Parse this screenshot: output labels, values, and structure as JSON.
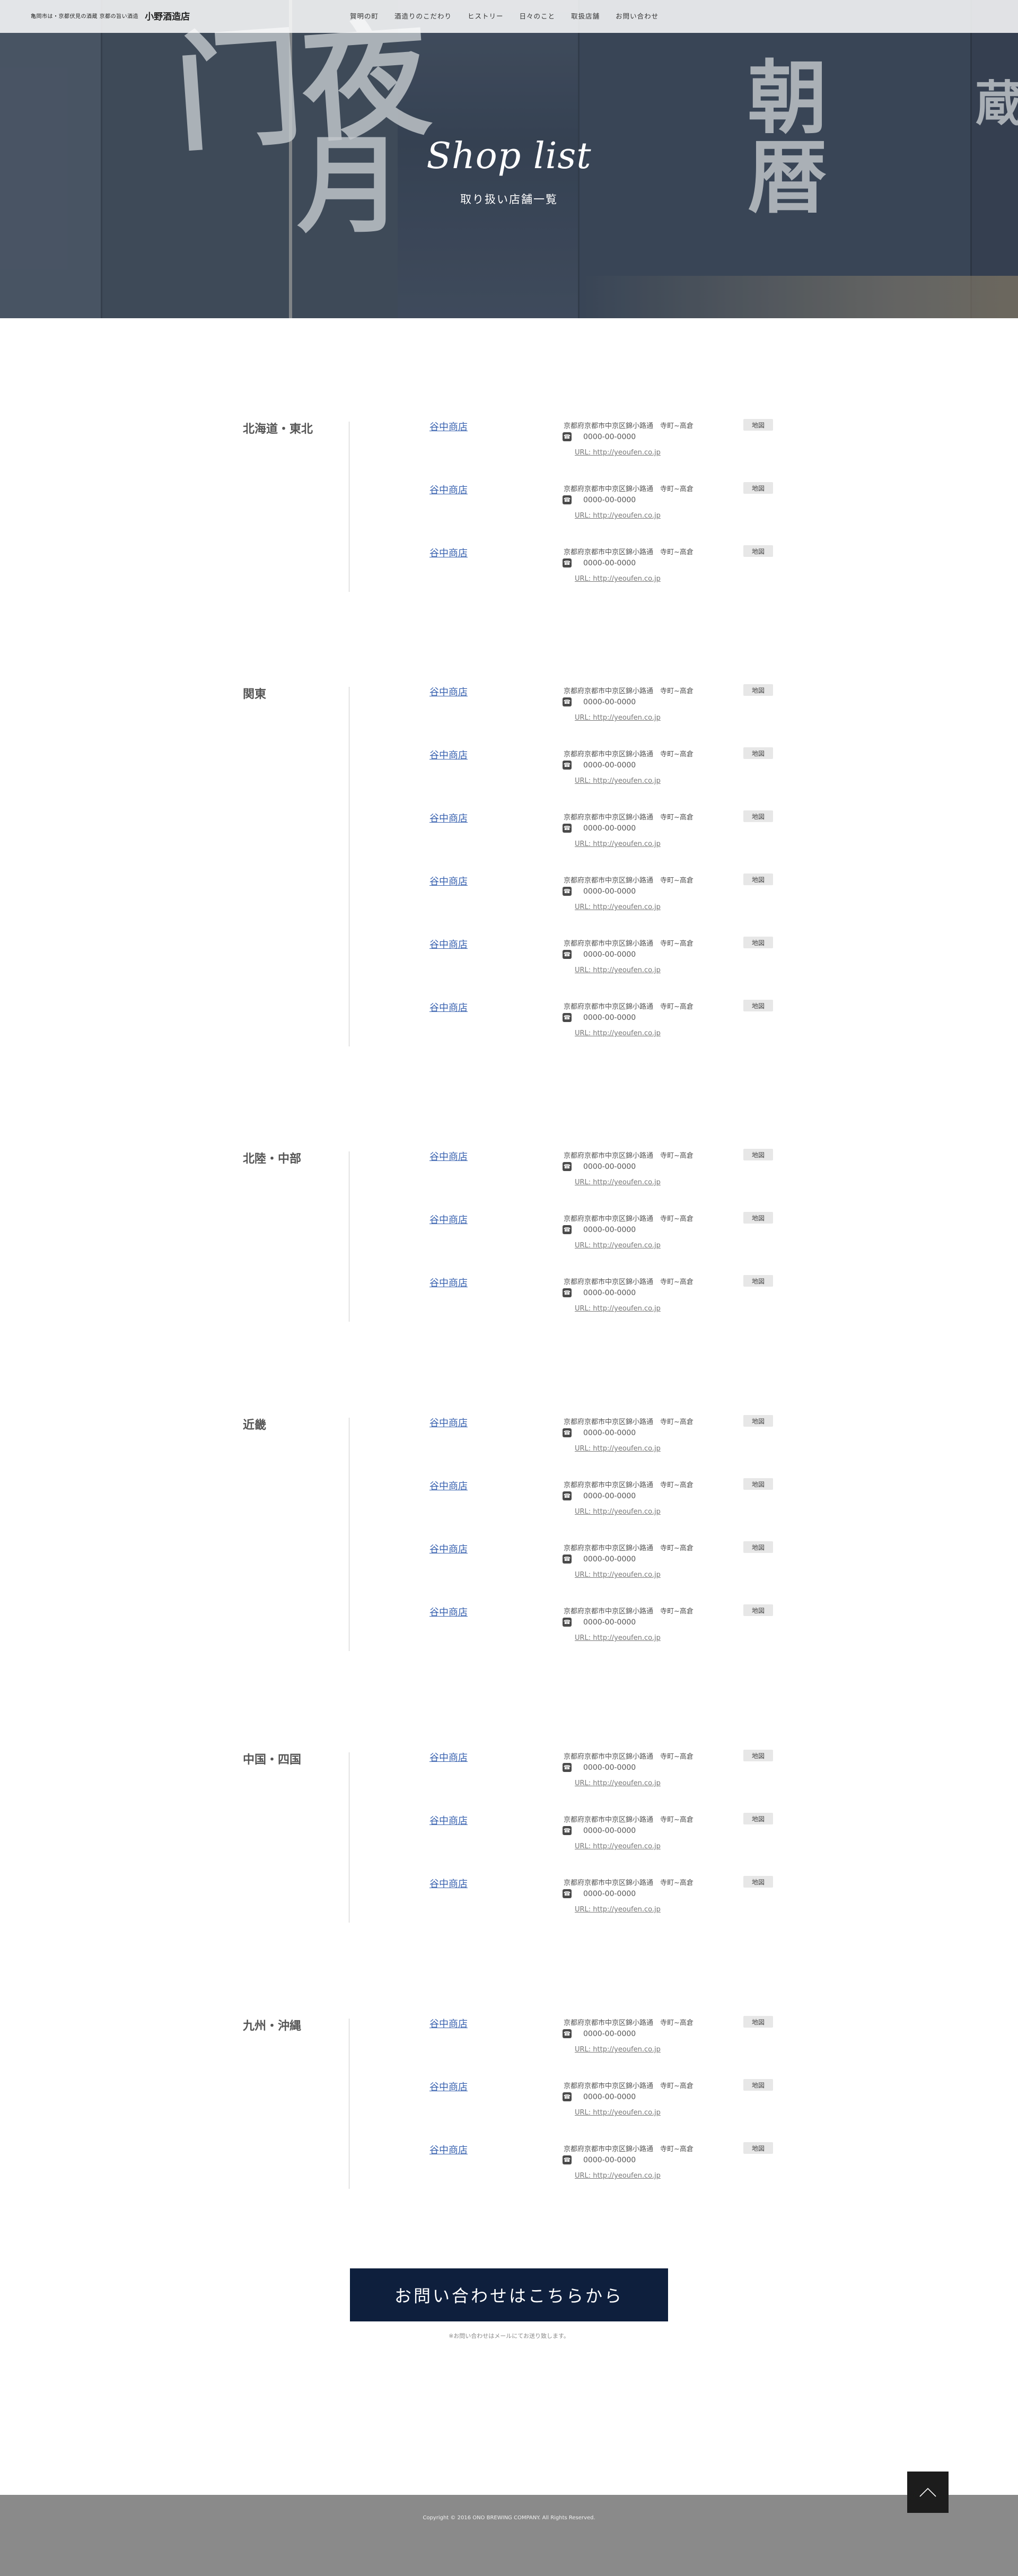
{
  "header": {
    "tagline": "亀岡市は・京都伏見の酒蔵 京都の旨い酒造",
    "brand_name": "小野酒造店",
    "nav": [
      "賀明の町",
      "酒造りのこだわり",
      "ヒストリー",
      "日々のこと",
      "取扱店舗",
      "お問い合わせ"
    ]
  },
  "hero": {
    "title": "Shop list",
    "subtitle": "取り扱い店舗一覧"
  },
  "regions": [
    {
      "name": "北海道・東北",
      "shops": [
        {
          "name": "谷中商店",
          "address": "京都府京都市中京区錦小路通　寺町~高倉",
          "tel": "0000-00-0000",
          "url": "URL: http://yeoufen.co.jp",
          "map": "地図"
        },
        {
          "name": "谷中商店",
          "address": "京都府京都市中京区錦小路通　寺町~高倉",
          "tel": "0000-00-0000",
          "url": "URL: http://yeoufen.co.jp",
          "map": "地図"
        },
        {
          "name": "谷中商店",
          "address": "京都府京都市中京区錦小路通　寺町~高倉",
          "tel": "0000-00-0000",
          "url": "URL: http://yeoufen.co.jp",
          "map": "地図"
        }
      ]
    },
    {
      "name": "関東",
      "shops": [
        {
          "name": "谷中商店",
          "address": "京都府京都市中京区錦小路通　寺町~高倉",
          "tel": "0000-00-0000",
          "url": "URL: http://yeoufen.co.jp",
          "map": "地図"
        },
        {
          "name": "谷中商店",
          "address": "京都府京都市中京区錦小路通　寺町~高倉",
          "tel": "0000-00-0000",
          "url": "URL: http://yeoufen.co.jp",
          "map": "地図"
        },
        {
          "name": "谷中商店",
          "address": "京都府京都市中京区錦小路通　寺町~高倉",
          "tel": "0000-00-0000",
          "url": "URL: http://yeoufen.co.jp",
          "map": "地図"
        },
        {
          "name": "谷中商店",
          "address": "京都府京都市中京区錦小路通　寺町~高倉",
          "tel": "0000-00-0000",
          "url": "URL: http://yeoufen.co.jp",
          "map": "地図"
        },
        {
          "name": "谷中商店",
          "address": "京都府京都市中京区錦小路通　寺町~高倉",
          "tel": "0000-00-0000",
          "url": "URL: http://yeoufen.co.jp",
          "map": "地図"
        },
        {
          "name": "谷中商店",
          "address": "京都府京都市中京区錦小路通　寺町~高倉",
          "tel": "0000-00-0000",
          "url": "URL: http://yeoufen.co.jp",
          "map": "地図"
        }
      ]
    },
    {
      "name": "北陸・中部",
      "shops": [
        {
          "name": "谷中商店",
          "address": "京都府京都市中京区錦小路通　寺町~高倉",
          "tel": "0000-00-0000",
          "url": "URL: http://yeoufen.co.jp",
          "map": "地図"
        },
        {
          "name": "谷中商店",
          "address": "京都府京都市中京区錦小路通　寺町~高倉",
          "tel": "0000-00-0000",
          "url": "URL: http://yeoufen.co.jp",
          "map": "地図"
        },
        {
          "name": "谷中商店",
          "address": "京都府京都市中京区錦小路通　寺町~高倉",
          "tel": "0000-00-0000",
          "url": "URL: http://yeoufen.co.jp",
          "map": "地図"
        }
      ]
    },
    {
      "name": "近畿",
      "shops": [
        {
          "name": "谷中商店",
          "address": "京都府京都市中京区錦小路通　寺町~高倉",
          "tel": "0000-00-0000",
          "url": "URL: http://yeoufen.co.jp",
          "map": "地図"
        },
        {
          "name": "谷中商店",
          "address": "京都府京都市中京区錦小路通　寺町~高倉",
          "tel": "0000-00-0000",
          "url": "URL: http://yeoufen.co.jp",
          "map": "地図"
        },
        {
          "name": "谷中商店",
          "address": "京都府京都市中京区錦小路通　寺町~高倉",
          "tel": "0000-00-0000",
          "url": "URL: http://yeoufen.co.jp",
          "map": "地図"
        },
        {
          "name": "谷中商店",
          "address": "京都府京都市中京区錦小路通　寺町~高倉",
          "tel": "0000-00-0000",
          "url": "URL: http://yeoufen.co.jp",
          "map": "地図"
        }
      ]
    },
    {
      "name": "中国・四国",
      "shops": [
        {
          "name": "谷中商店",
          "address": "京都府京都市中京区錦小路通　寺町~高倉",
          "tel": "0000-00-0000",
          "url": "URL: http://yeoufen.co.jp",
          "map": "地図"
        },
        {
          "name": "谷中商店",
          "address": "京都府京都市中京区錦小路通　寺町~高倉",
          "tel": "0000-00-0000",
          "url": "URL: http://yeoufen.co.jp",
          "map": "地図"
        },
        {
          "name": "谷中商店",
          "address": "京都府京都市中京区錦小路通　寺町~高倉",
          "tel": "0000-00-0000",
          "url": "URL: http://yeoufen.co.jp",
          "map": "地図"
        }
      ]
    },
    {
      "name": "九州・沖縄",
      "shops": [
        {
          "name": "谷中商店",
          "address": "京都府京都市中京区錦小路通　寺町~高倉",
          "tel": "0000-00-0000",
          "url": "URL: http://yeoufen.co.jp",
          "map": "地図"
        },
        {
          "name": "谷中商店",
          "address": "京都府京都市中京区錦小路通　寺町~高倉",
          "tel": "0000-00-0000",
          "url": "URL: http://yeoufen.co.jp",
          "map": "地図"
        },
        {
          "name": "谷中商店",
          "address": "京都府京都市中京区錦小路通　寺町~高倉",
          "tel": "0000-00-0000",
          "url": "URL: http://yeoufen.co.jp",
          "map": "地図"
        }
      ]
    }
  ],
  "contact": {
    "button_label": "お問い合わせはこちらから",
    "note": "※お問い合わせはメールにてお送り致します。"
  },
  "pagetop": {
    "icon": "chevron-up-icon"
  },
  "footer": {
    "copyright": "Copyright © 2016 ONO BREWING COMPANY. All Rights Reserved."
  },
  "colors": {
    "accent": "#0e1f3d",
    "link": "#3a63b0",
    "footer_bg": "#8a8a8a"
  }
}
